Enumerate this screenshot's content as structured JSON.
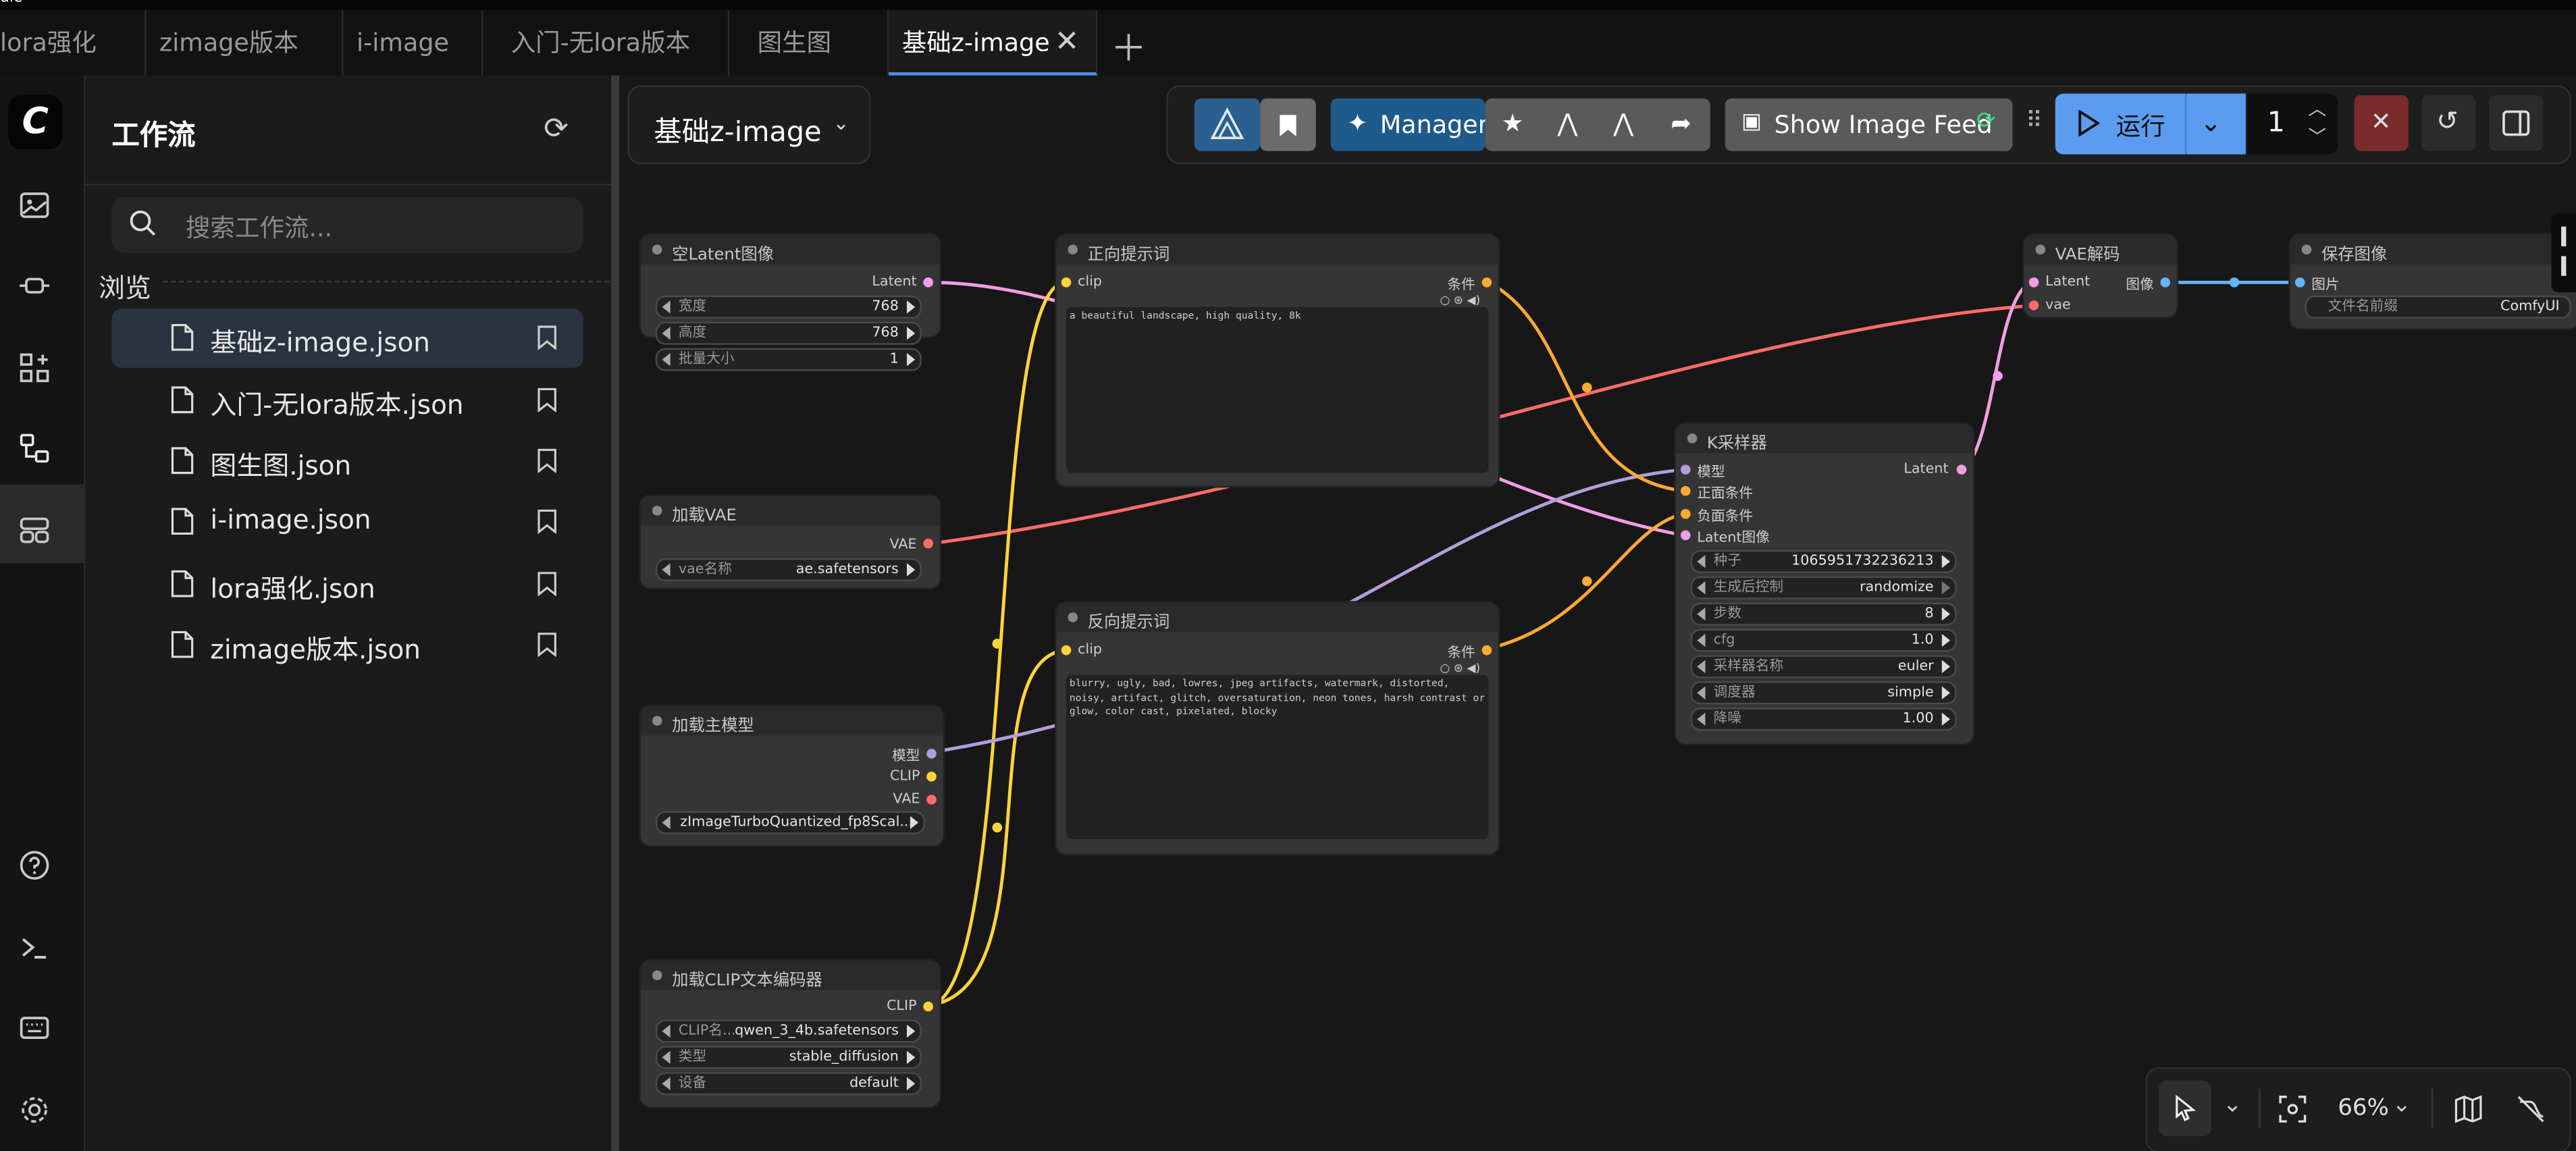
{
  "tabs": [
    {
      "label": "lora强化",
      "active": false
    },
    {
      "label": "zimage版本",
      "active": false
    },
    {
      "label": "i-image",
      "active": false
    },
    {
      "label": "入门-无lora版本",
      "active": false
    },
    {
      "label": "图生图",
      "active": false
    },
    {
      "label": "基础z-image",
      "active": true
    }
  ],
  "top_strip_label": "ule",
  "sidebar": {
    "title": "工作流",
    "search_placeholder": "搜索工作流...",
    "browse_label": "浏览",
    "files": [
      {
        "name": "基础z-image.json",
        "active": true
      },
      {
        "name": "入门-无lora版本.json",
        "active": false
      },
      {
        "name": "图生图.json",
        "active": false
      },
      {
        "name": "i-image.json",
        "active": false
      },
      {
        "name": "lora强化.json",
        "active": false
      },
      {
        "name": "zimage版本.json",
        "active": false
      }
    ]
  },
  "workflow_name": "基础z-image",
  "toolbar": {
    "manager_label": "Manager",
    "image_feed_label": "Show Image Feed",
    "run_label": "运行",
    "queue_count": "1"
  },
  "zoom_label": "66%",
  "nodes": {
    "empty_latent": {
      "title": "空Latent图像",
      "output": "Latent",
      "widgets": [
        {
          "label": "宽度",
          "value": "768"
        },
        {
          "label": "高度",
          "value": "768"
        },
        {
          "label": "批量大小",
          "value": "1"
        }
      ]
    },
    "load_vae": {
      "title": "加载VAE",
      "output": "VAE",
      "widgets": [
        {
          "label": "vae名称",
          "value": "ae.safetensors"
        }
      ]
    },
    "load_model": {
      "title": "加载主模型",
      "outputs": [
        "模型",
        "CLIP",
        "VAE"
      ],
      "widgets": [
        {
          "label": "",
          "value": "zImageTurboQuantized_fp8Scal..."
        }
      ]
    },
    "load_clip": {
      "title": "加载CLIP文本编码器",
      "output": "CLIP",
      "widgets": [
        {
          "label": "CLIP名...",
          "value": "qwen_3_4b.safetensors"
        },
        {
          "label": "类型",
          "value": "stable_diffusion"
        },
        {
          "label": "设备",
          "value": "default"
        }
      ]
    },
    "positive": {
      "title": "正向提示词",
      "input": "clip",
      "output": "条件",
      "text": "a beautiful landscape, high quality, 8k"
    },
    "negative": {
      "title": "反向提示词",
      "input": "clip",
      "output": "条件",
      "text": "blurry, ugly, bad, lowres, jpeg artifacts, watermark, distorted, noisy, artifact, glitch, oversaturation, neon tones, harsh contrast or glow, color cast, pixelated, blocky"
    },
    "ksampler": {
      "title": "K采样器",
      "inputs": [
        "模型",
        "正面条件",
        "负面条件",
        "Latent图像"
      ],
      "output": "Latent",
      "widgets": [
        {
          "label": "种子",
          "value": "1065951732236213"
        },
        {
          "label": "生成后控制",
          "value": "randomize"
        },
        {
          "label": "步数",
          "value": "8"
        },
        {
          "label": "cfg",
          "value": "1.0"
        },
        {
          "label": "采样器名称",
          "value": "euler"
        },
        {
          "label": "调度器",
          "value": "simple"
        },
        {
          "label": "降噪",
          "value": "1.00"
        }
      ]
    },
    "vae_decode": {
      "title": "VAE解码",
      "inputs": [
        "Latent",
        "vae"
      ],
      "output": "图像"
    },
    "save_image": {
      "title": "保存图像",
      "input": "图片",
      "widgets": [
        {
          "label": "文件名前缀",
          "value": "ComfyUI"
        }
      ]
    }
  },
  "colors": {
    "accent": "#4a8fe0",
    "run_button": "#5b9cf0",
    "manager": "#1e5a8a",
    "latent_wire": "#f19ee5",
    "clip_wire": "#ffd43a",
    "vae_wire": "#ff6b6b",
    "model_wire": "#b39ddb",
    "cond_wire": "#ffa931",
    "image_wire": "#64b5f6"
  }
}
